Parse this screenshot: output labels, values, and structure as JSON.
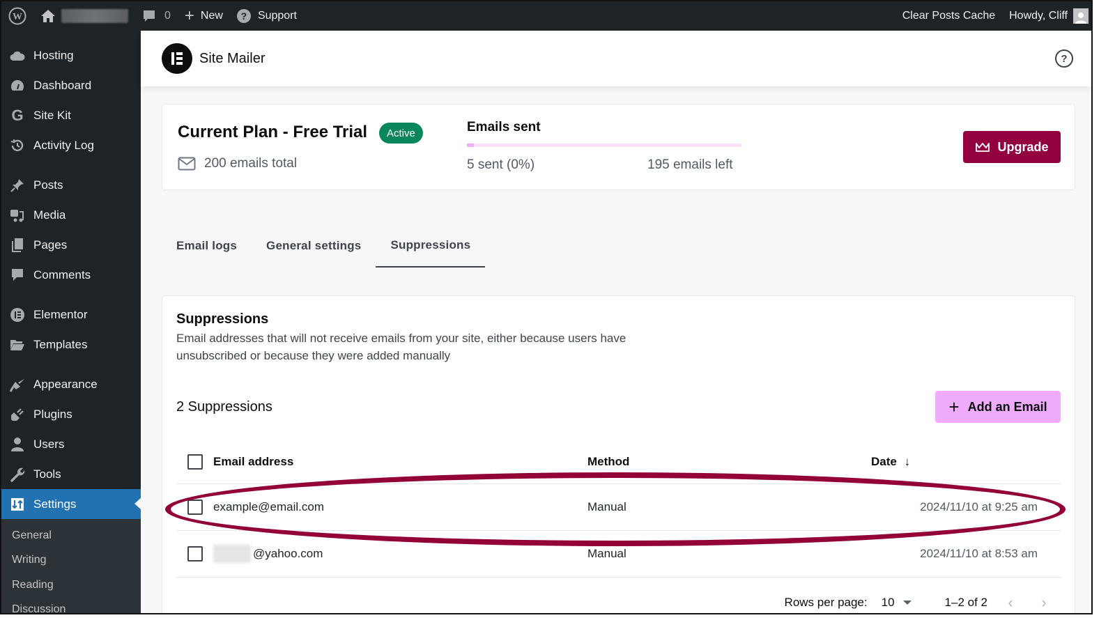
{
  "adminbar": {
    "comments_count": "0",
    "new_label": "New",
    "support_label": "Support",
    "clear_cache_label": "Clear Posts Cache",
    "howdy_label": "Howdy, Cliff"
  },
  "sidebar": {
    "items": [
      {
        "label": "Hosting",
        "icon": "cloud-icon"
      },
      {
        "label": "Dashboard",
        "icon": "dashboard-icon"
      },
      {
        "label": "Site Kit",
        "icon": "google-icon"
      },
      {
        "label": "Activity Log",
        "icon": "history-icon"
      },
      {
        "label": "Posts",
        "icon": "pin-icon"
      },
      {
        "label": "Media",
        "icon": "media-icon"
      },
      {
        "label": "Pages",
        "icon": "pages-icon"
      },
      {
        "label": "Comments",
        "icon": "comment-icon"
      },
      {
        "label": "Elementor",
        "icon": "elementor-icon"
      },
      {
        "label": "Templates",
        "icon": "folder-icon"
      },
      {
        "label": "Appearance",
        "icon": "brush-icon"
      },
      {
        "label": "Plugins",
        "icon": "plug-icon"
      },
      {
        "label": "Users",
        "icon": "user-icon"
      },
      {
        "label": "Tools",
        "icon": "wrench-icon"
      },
      {
        "label": "Settings",
        "icon": "settings-icon",
        "active": true
      }
    ],
    "submenu": [
      "General",
      "Writing",
      "Reading",
      "Discussion"
    ]
  },
  "header": {
    "app_title": "Site Mailer"
  },
  "plan": {
    "title": "Current Plan - Free Trial",
    "status": "Active",
    "total": "200 emails total",
    "sent_label": "Emails sent",
    "sent_value": "5 sent (0%)",
    "left_value": "195 emails left",
    "progress_percent": 2.5,
    "upgrade_label": "Upgrade"
  },
  "tabs": [
    {
      "label": "Email logs",
      "active": false
    },
    {
      "label": "General settings",
      "active": false
    },
    {
      "label": "Suppressions",
      "active": true
    }
  ],
  "suppressions": {
    "title": "Suppressions",
    "description": "Email addresses that will not receive emails from your site, either because users have unsubscribed or because they were added manually",
    "count_label": "2 Suppressions",
    "add_label": "Add an Email",
    "columns": {
      "email": "Email address",
      "method": "Method",
      "date": "Date"
    },
    "rows": [
      {
        "email": "example@email.com",
        "method": "Manual",
        "date": "2024/11/10 at 9:25 am",
        "highlighted": true
      },
      {
        "email": "@yahoo.com",
        "method": "Manual",
        "date": "2024/11/10 at 8:53 am",
        "redacted_prefix": true
      }
    ],
    "pager": {
      "rows_label": "Rows per page:",
      "rows_value": "10",
      "range": "1–2 of 2"
    }
  },
  "colors": {
    "accent": "#93003f",
    "add_button": "#f0abfc",
    "active_badge": "#0a875a",
    "wp_blue": "#2271b1"
  }
}
